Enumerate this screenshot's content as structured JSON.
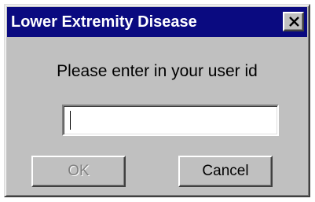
{
  "dialog": {
    "title": "Lower Extremity Disease",
    "close_icon": "close-x-icon",
    "prompt": "Please enter in your user id",
    "user_id": {
      "value": "",
      "placeholder": ""
    },
    "ok_label": "OK",
    "ok_enabled": false,
    "cancel_label": "Cancel"
  },
  "colors": {
    "titlebar": "#0a0a80",
    "face": "#c0c0c0",
    "disabled_text": "#808080"
  }
}
